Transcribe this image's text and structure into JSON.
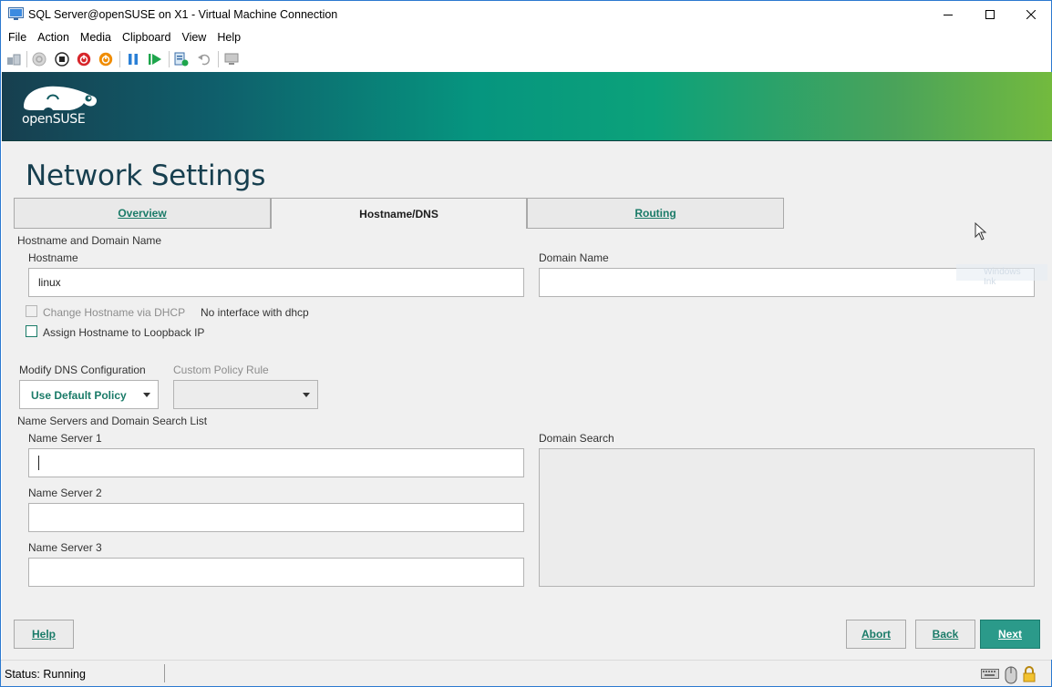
{
  "window": {
    "title": "SQL Server@openSUSE on X1 - Virtual Machine Connection"
  },
  "menubar": {
    "items": [
      "File",
      "Action",
      "Media",
      "Clipboard",
      "View",
      "Help"
    ]
  },
  "toolbar": {
    "icons": [
      "ctrl-alt-del-icon",
      "start-icon",
      "turn-off-icon",
      "shut-down-icon",
      "save-icon",
      "pause-icon",
      "reset-icon",
      "checkpoint-icon",
      "revert-icon",
      "enhanced-session-icon"
    ]
  },
  "banner": {
    "logo_text": "openSUSE",
    "colors": {
      "dark": "#173f4f",
      "teal": "#06957f",
      "green": "#73ba3e"
    }
  },
  "page": {
    "title": "Network Settings"
  },
  "tabs": [
    {
      "label": "Overview",
      "active": false
    },
    {
      "label": "Hostname/DNS",
      "active": true
    },
    {
      "label": "Routing",
      "active": false
    }
  ],
  "hostname_section": {
    "heading": "Hostname and Domain Name",
    "hostname_label": "Hostname",
    "hostname_value": "linux",
    "domain_label": "Domain Name",
    "domain_value": "",
    "dhcp_checkbox_label": "Change Hostname via DHCP",
    "dhcp_note": "No interface with dhcp",
    "loopback_checkbox_label": "Assign Hostname to Loopback IP"
  },
  "dns_config": {
    "modify_label": "Modify DNS Configuration",
    "modify_value": "Use Default Policy",
    "custom_policy_label": "Custom Policy Rule",
    "custom_policy_value": ""
  },
  "nameservers": {
    "heading": "Name Servers and Domain Search List",
    "ns1_label": "Name Server 1",
    "ns1_value": "",
    "ns2_label": "Name Server 2",
    "ns2_value": "",
    "ns3_label": "Name Server 3",
    "ns3_value": "",
    "domain_search_label": "Domain Search"
  },
  "buttons": {
    "help": "Help",
    "abort": "Abort",
    "back": "Back",
    "next": "Next"
  },
  "ghost_text": "Windows Ink",
  "status": {
    "text": "Status: Running"
  },
  "accent_color": "#1a7b68"
}
